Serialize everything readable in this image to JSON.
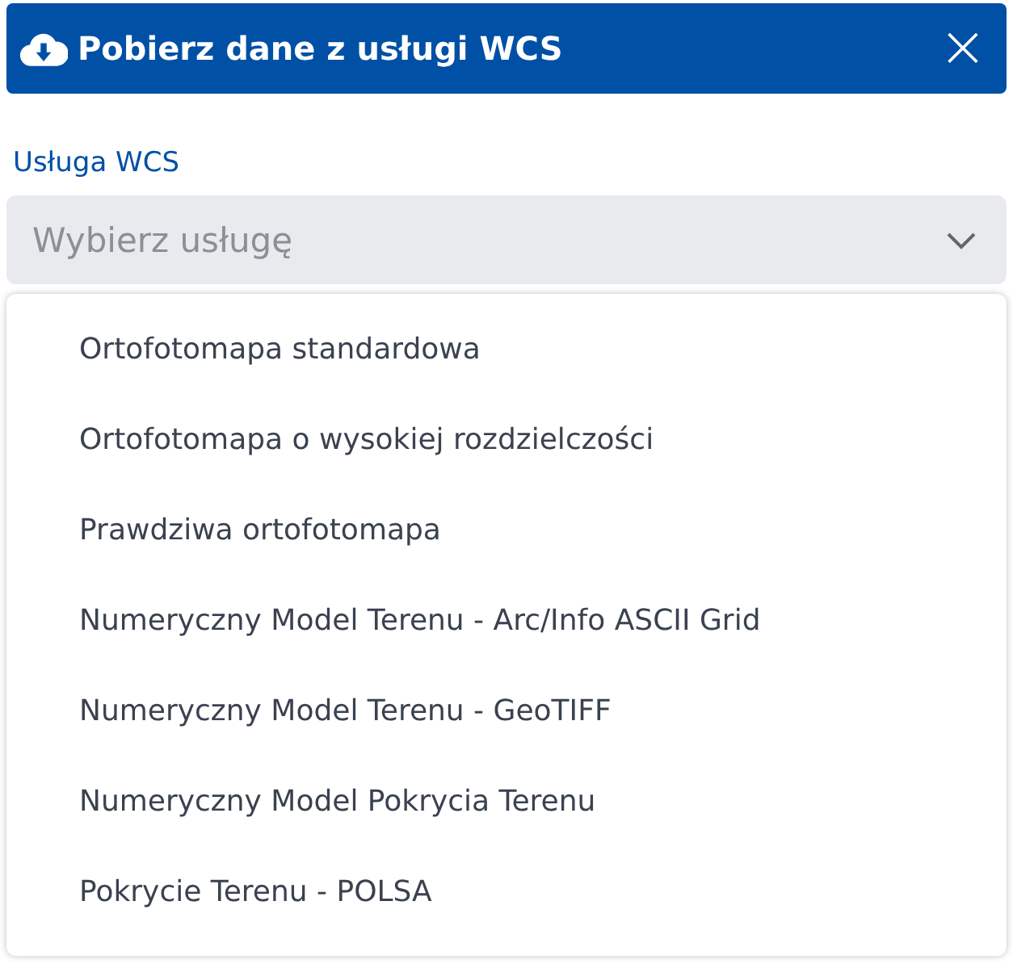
{
  "dialog": {
    "title": "Pobierz dane z usługi WCS",
    "close": "×"
  },
  "field": {
    "label": "Usługa WCS",
    "placeholder": "Wybierz usługę"
  },
  "options": [
    "Ortofotomapa standardowa",
    "Ortofotomapa o wysokiej rozdzielczości",
    "Prawdziwa ortofotomapa",
    "Numeryczny Model Terenu - Arc/Info ASCII Grid",
    "Numeryczny Model Terenu - GeoTIFF",
    "Numeryczny Model Pokrycia Terenu",
    "Pokrycie Terenu - POLSA"
  ]
}
